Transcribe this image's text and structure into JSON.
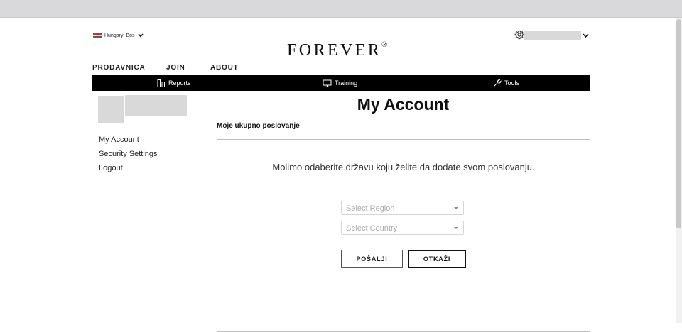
{
  "locale": {
    "country": "Hungary",
    "language": "Bos",
    "flag_colors": [
      "#cd2a3e",
      "#ffffff",
      "#436f4d"
    ]
  },
  "brand": {
    "name": "FOREVER",
    "mark": "®"
  },
  "user": {
    "gear_icon": "gear-icon",
    "name": ""
  },
  "main_nav": [
    "PRODAVNICA",
    "JOIN",
    "ABOUT"
  ],
  "toolbar": {
    "items": [
      {
        "label": "Reports",
        "icon": "bar-chart-icon"
      },
      {
        "label": "Training",
        "icon": "monitor-icon"
      },
      {
        "label": "Tools",
        "icon": "wrench-icon"
      }
    ]
  },
  "sidebar": {
    "items": [
      {
        "label": "My Account"
      },
      {
        "label": "Security Settings"
      },
      {
        "label": "Logout"
      }
    ]
  },
  "page": {
    "title": "My Account",
    "subtitle": "Moje ukupno poslovanje",
    "prompt": "Molimo odaberite državu koju želite da dodate svom poslovanju.",
    "region_placeholder": "Select Region",
    "country_placeholder": "Select Country",
    "submit_label": "POŠALJI",
    "cancel_label": "OTKAŽI"
  }
}
